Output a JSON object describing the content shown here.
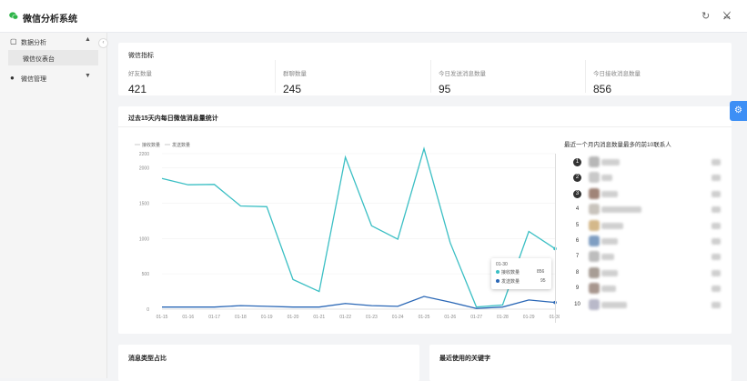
{
  "app": {
    "title": "微信分析系统"
  },
  "topbar": {
    "refresh_icon": "refresh-icon",
    "settings_icon": "brand-glyph-icon"
  },
  "sidebar": {
    "menus": [
      {
        "label": "数据分析",
        "icon": "chart-icon",
        "expanded": true,
        "children": [
          {
            "label": "微信仪表台",
            "active": true
          }
        ]
      },
      {
        "label": "微信管理",
        "icon": "wechat-icon",
        "expanded": false,
        "children": []
      }
    ]
  },
  "stats": {
    "title": "微信指标",
    "items": [
      {
        "label": "好友数量",
        "value": "421"
      },
      {
        "label": "群聊数量",
        "value": "245"
      },
      {
        "label": "今日发送消息数量",
        "value": "95"
      },
      {
        "label": "今日接收消息数量",
        "value": "856"
      }
    ]
  },
  "trend": {
    "title": "过去15天内每日微信消息量统计",
    "legend": [
      "接收数量",
      "发送数量"
    ],
    "tooltip": {
      "date": "01-30",
      "rows": [
        {
          "label": "接收数量",
          "value": "856"
        },
        {
          "label": "发送数量",
          "value": "95"
        }
      ]
    },
    "panel_title": "最近一个月内消息数量最多的前10联系人",
    "ranks": [
      "1",
      "2",
      "3",
      "4",
      "5",
      "6",
      "7",
      "8",
      "9",
      "10"
    ]
  },
  "chart_data": {
    "type": "line",
    "x": [
      "01-15",
      "01-16",
      "01-17",
      "01-18",
      "01-19",
      "01-20",
      "01-21",
      "01-22",
      "01-23",
      "01-24",
      "01-25",
      "01-26",
      "01-27",
      "01-28",
      "01-29",
      "01-30"
    ],
    "series": [
      {
        "name": "接收数量",
        "color": "#3bbfc4",
        "values": [
          1850,
          1760,
          1765,
          1460,
          1450,
          420,
          250,
          2150,
          1180,
          990,
          2270,
          940,
          30,
          60,
          1100,
          856
        ]
      },
      {
        "name": "发送数量",
        "color": "#2a67b6",
        "values": [
          30,
          30,
          30,
          50,
          40,
          30,
          30,
          80,
          50,
          40,
          180,
          100,
          10,
          30,
          130,
          95
        ]
      }
    ],
    "y_ticks": [
      "0",
      "500",
      "1000",
      "1500",
      "2000",
      "2200"
    ],
    "ylim": [
      0,
      2200
    ]
  },
  "bottom": {
    "left_title": "消息类型占比",
    "right_title": "最近使用的关键字"
  },
  "colors": {
    "accent": "#3d8ff5",
    "receive": "#3bbfc4",
    "send": "#2a67b6",
    "brand": "#2fb54a"
  }
}
